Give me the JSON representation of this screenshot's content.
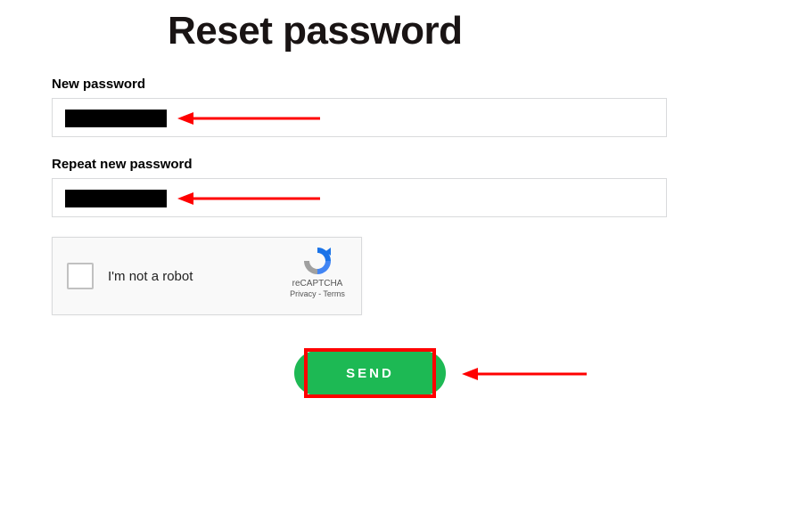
{
  "page": {
    "title": "Reset password"
  },
  "fields": {
    "new_password": {
      "label": "New password",
      "value": ""
    },
    "repeat_password": {
      "label": "Repeat new password",
      "value": ""
    }
  },
  "recaptcha": {
    "label": "I'm not a robot",
    "brand": "reCAPTCHA",
    "links": "Privacy - Terms"
  },
  "actions": {
    "send": "SEND"
  },
  "colors": {
    "accent_green": "#1db954",
    "annotation_red": "#ff0000"
  }
}
